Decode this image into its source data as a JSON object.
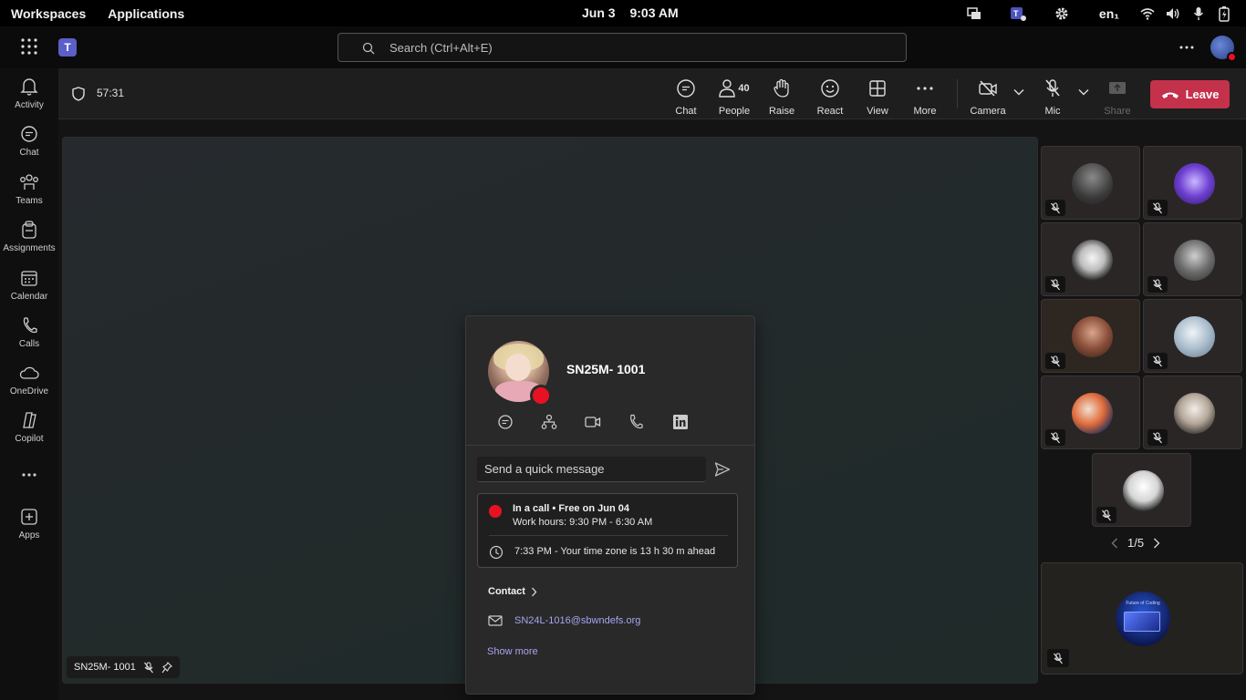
{
  "os_bar": {
    "workspaces": "Workspaces",
    "applications": "Applications",
    "date": "Jun 3",
    "time": "9:03 AM",
    "language": "en₁",
    "tray_icons": [
      "windows-icon",
      "teams-tray-icon",
      "settings-icon",
      "wifi-icon",
      "volume-icon",
      "microphone-icon",
      "battery-icon"
    ]
  },
  "teams_header": {
    "search_placeholder": "Search (Ctrl+Alt+E)",
    "logo_letter": "T"
  },
  "rail": [
    {
      "label": "Activity",
      "icon": "bell-icon"
    },
    {
      "label": "Chat",
      "icon": "chat-icon"
    },
    {
      "label": "Teams",
      "icon": "teams-icon"
    },
    {
      "label": "Assignments",
      "icon": "assignments-icon"
    },
    {
      "label": "Calendar",
      "icon": "calendar-icon"
    },
    {
      "label": "Calls",
      "icon": "phone-icon"
    },
    {
      "label": "OneDrive",
      "icon": "cloud-icon"
    },
    {
      "label": "Copilot",
      "icon": "copilot-icon"
    },
    {
      "label": "",
      "icon": "more-icon"
    },
    {
      "label": "Apps",
      "icon": "apps-icon"
    }
  ],
  "meeting": {
    "timer": "57:31",
    "people_count": "40",
    "toolbar": {
      "chat": "Chat",
      "people": "People",
      "raise": "Raise",
      "react": "React",
      "view": "View",
      "more": "More",
      "camera": "Camera",
      "mic": "Mic",
      "share": "Share",
      "leave": "Leave"
    },
    "main_speaker_name": "SN25M- 1001",
    "pager": "1/5"
  },
  "profile_card": {
    "name": "SN25M- 1001",
    "quick_message_placeholder": "Send a quick message",
    "status_line": "In a call • Free on Jun 04",
    "work_hours": "Work hours: 9:30 PM - 6:30 AM",
    "local_time": "7:33 PM - Your time zone is 13 h 30 m ahead",
    "contact_label": "Contact",
    "email": "SN24L-1016@sbwndefs.org",
    "show_more": "Show more"
  },
  "screen_tile": {
    "caption": "Future of Coding"
  },
  "colors": {
    "leave": "#c4314b",
    "presence_busy": "#e81123",
    "link": "#a8a4f0",
    "teams_brand": "#5b5fc7"
  }
}
